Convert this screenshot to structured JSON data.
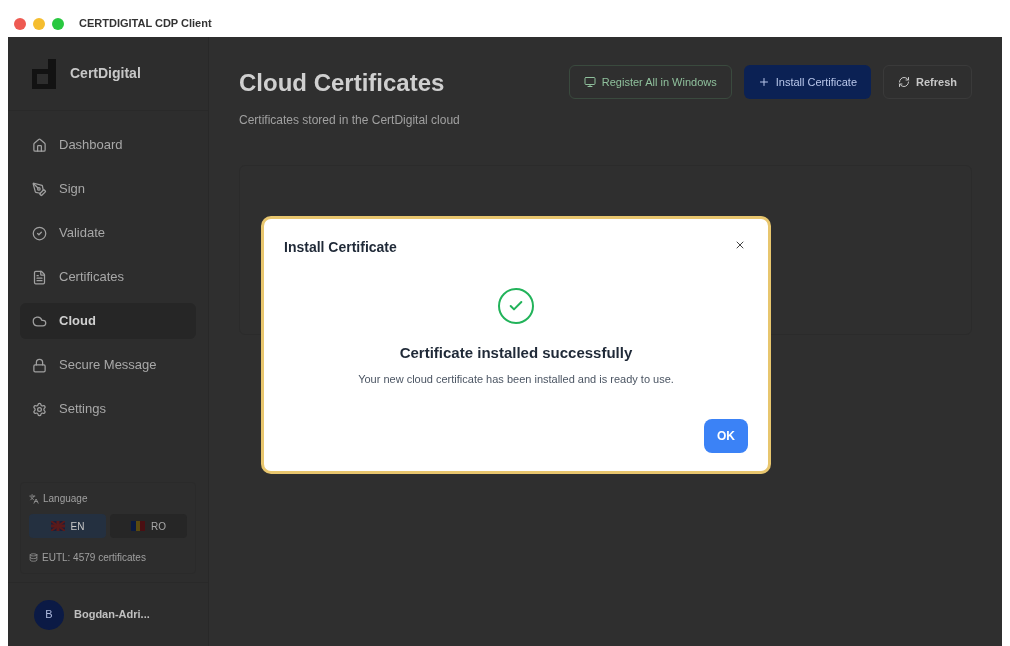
{
  "window": {
    "title": "CERTDIGITAL CDP Client"
  },
  "sidebar": {
    "brand": "CertDigital",
    "items": [
      {
        "label": "Dashboard",
        "selected": false
      },
      {
        "label": "Sign",
        "selected": false
      },
      {
        "label": "Validate",
        "selected": false
      },
      {
        "label": "Certificates",
        "selected": false
      },
      {
        "label": "Cloud",
        "selected": true
      },
      {
        "label": "Secure Message",
        "selected": false
      },
      {
        "label": "Settings",
        "selected": false
      }
    ],
    "language": {
      "label": "Language",
      "options": [
        {
          "label": "EN",
          "selected": true
        },
        {
          "label": "RO",
          "selected": false
        }
      ]
    },
    "eutl": "EUTL: 4579 certificates",
    "user": {
      "initial": "B",
      "name": "Bogdan-Adri..."
    }
  },
  "page": {
    "title": "Cloud Certificates",
    "subtitle": "Certificates stored in the CertDigital cloud",
    "actions": [
      {
        "label": "Register All in Windows",
        "kind": "outline"
      },
      {
        "label": "Install Certificate",
        "kind": "primary"
      },
      {
        "label": "Refresh",
        "kind": "plain"
      }
    ]
  },
  "dialog": {
    "title": "Install Certificate",
    "heading": "Certificate installed successfully",
    "message": "Your new cloud certificate has been installed and is ready to use.",
    "button": "OK"
  }
}
